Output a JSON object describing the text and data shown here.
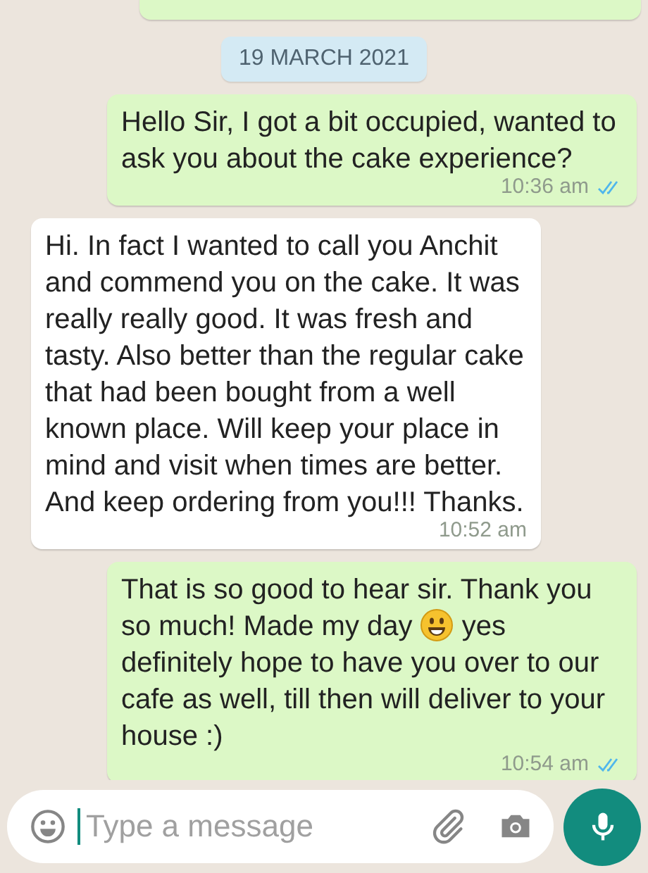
{
  "messages": [
    {
      "kind": "fragment"
    },
    {
      "kind": "date",
      "text": "19 MARCH 2021"
    },
    {
      "kind": "outgoing",
      "parts": [
        {
          "kind": "text",
          "text": "Hello Sir, I got a bit occupied, wanted to ask you about the cake experience?"
        }
      ],
      "time": "10:36 am",
      "read": true
    },
    {
      "kind": "incoming",
      "parts": [
        {
          "kind": "text",
          "text": "Hi. In fact I wanted to call you Anchit and commend you on the cake.  It was really really good.  It was fresh and tasty.  Also better than the regular cake that had been bought from a well known place. Will keep your place in mind and visit when times are better. And keep ordering from you!!! Thanks."
        }
      ],
      "time": "10:52 am"
    },
    {
      "kind": "outgoing",
      "parts": [
        {
          "kind": "text",
          "text": "That is so good to hear sir. Thank you so much! Made my day "
        },
        {
          "kind": "emoji"
        },
        {
          "kind": "text",
          "text": " yes definitely hope to have you over to our cafe as well, till then will deliver to your house :)"
        }
      ],
      "time": "10:54 am",
      "read": true
    }
  ],
  "composer": {
    "placeholder": "Type a message"
  }
}
